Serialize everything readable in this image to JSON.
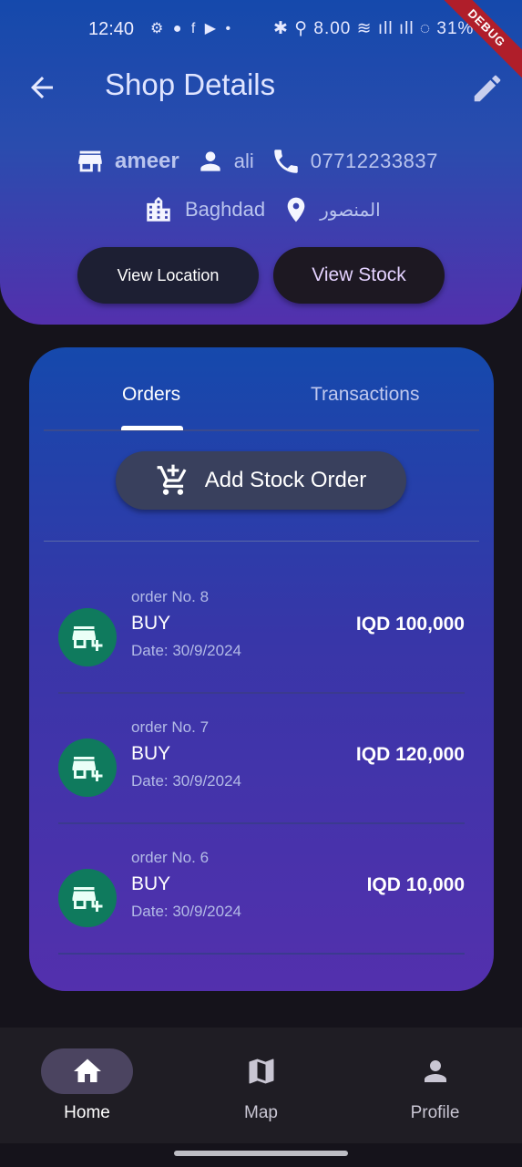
{
  "status_bar": {
    "time": "12:40",
    "icons_left": "⚙ ● f ▶ •",
    "icons_right": "✱ ⚲ 8.00 ≋ ıll ıll ◌ 31%"
  },
  "debug_banner": "DEBUG",
  "app_bar": {
    "title": "Shop Details"
  },
  "shop": {
    "name": "ameer",
    "owner": "ali",
    "phone": "07712233837",
    "city": "Baghdad",
    "district": "المنصور"
  },
  "header_buttons": {
    "view_location": "View Location",
    "view_stock": "View Stock"
  },
  "tabs": [
    {
      "label": "Orders"
    },
    {
      "label": "Transactions"
    }
  ],
  "add_stock_order": "Add Stock Order",
  "orders": [
    {
      "number": "order No. 8",
      "type": "BUY",
      "date": "Date: 30/9/2024",
      "amount": "IQD 100,000"
    },
    {
      "number": "order No. 7",
      "type": "BUY",
      "date": "Date: 30/9/2024",
      "amount": "IQD 120,000"
    },
    {
      "number": "order No. 6",
      "type": "BUY",
      "date": "Date: 30/9/2024",
      "amount": "IQD 10,000"
    }
  ],
  "bottom_nav": [
    {
      "label": "Home"
    },
    {
      "label": "Map"
    },
    {
      "label": "Profile"
    }
  ],
  "colors": {
    "header_top": "#1549ac",
    "header_bottom": "#5330ad",
    "avatar": "#0f7a5d",
    "nav_bg": "#1f1d24"
  }
}
